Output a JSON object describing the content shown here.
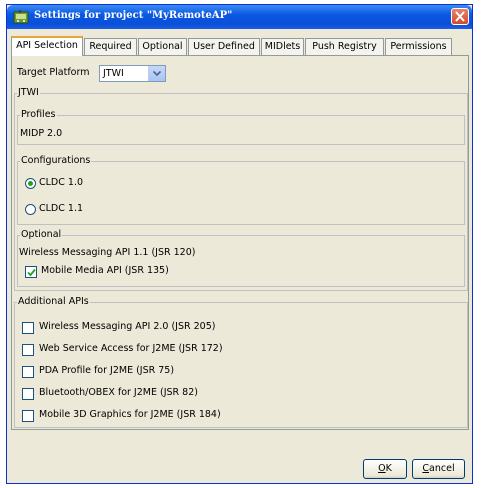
{
  "window": {
    "title": "Settings for project \"MyRemoteAP\""
  },
  "tabs": [
    {
      "label": "API Selection"
    },
    {
      "label": "Required"
    },
    {
      "label": "Optional"
    },
    {
      "label": "User Defined"
    },
    {
      "label": "MIDlets"
    },
    {
      "label": "Push Registry"
    },
    {
      "label": "Permissions"
    }
  ],
  "target_platform": {
    "label": "Target Platform",
    "value": "JTWI"
  },
  "jtwi_group": {
    "legend": "JTWI",
    "profiles": {
      "legend": "Profiles",
      "value": "MIDP 2.0"
    },
    "configurations": {
      "legend": "Configurations",
      "options": [
        {
          "label": "CLDC 1.0",
          "selected": true
        },
        {
          "label": "CLDC 1.1",
          "selected": false
        }
      ]
    },
    "optional": {
      "legend": "Optional",
      "fixed_item": "Wireless Messaging API 1.1 (JSR 120)",
      "items": [
        {
          "label": "Mobile Media API (JSR 135)",
          "checked": true
        }
      ]
    }
  },
  "additional_apis": {
    "legend": "Additional APIs",
    "items": [
      {
        "label": "Wireless Messaging API 2.0 (JSR 205)",
        "checked": false
      },
      {
        "label": "Web Service Access for J2ME (JSR 172)",
        "checked": false
      },
      {
        "label": "PDA Profile for J2ME (JSR 75)",
        "checked": false
      },
      {
        "label": "Bluetooth/OBEX for J2ME (JSR 82)",
        "checked": false
      },
      {
        "label": "Mobile 3D Graphics for J2ME (JSR 184)",
        "checked": false
      }
    ]
  },
  "buttons": {
    "ok_label_mnemonic": "O",
    "ok_label_rest": "K",
    "cancel_label_mnemonic": "C",
    "cancel_label_rest": "ancel"
  },
  "colors": {
    "title_bar": "#0a58e4",
    "close_button": "#d14b2c",
    "active_tab_accent": "#e8a53a",
    "check_green": "#21a121"
  },
  "icons": {
    "app_icon": "wireless-toolkit-icon",
    "close": "close-icon",
    "dropdown": "chevron-down-icon",
    "check": "checkmark-icon"
  }
}
